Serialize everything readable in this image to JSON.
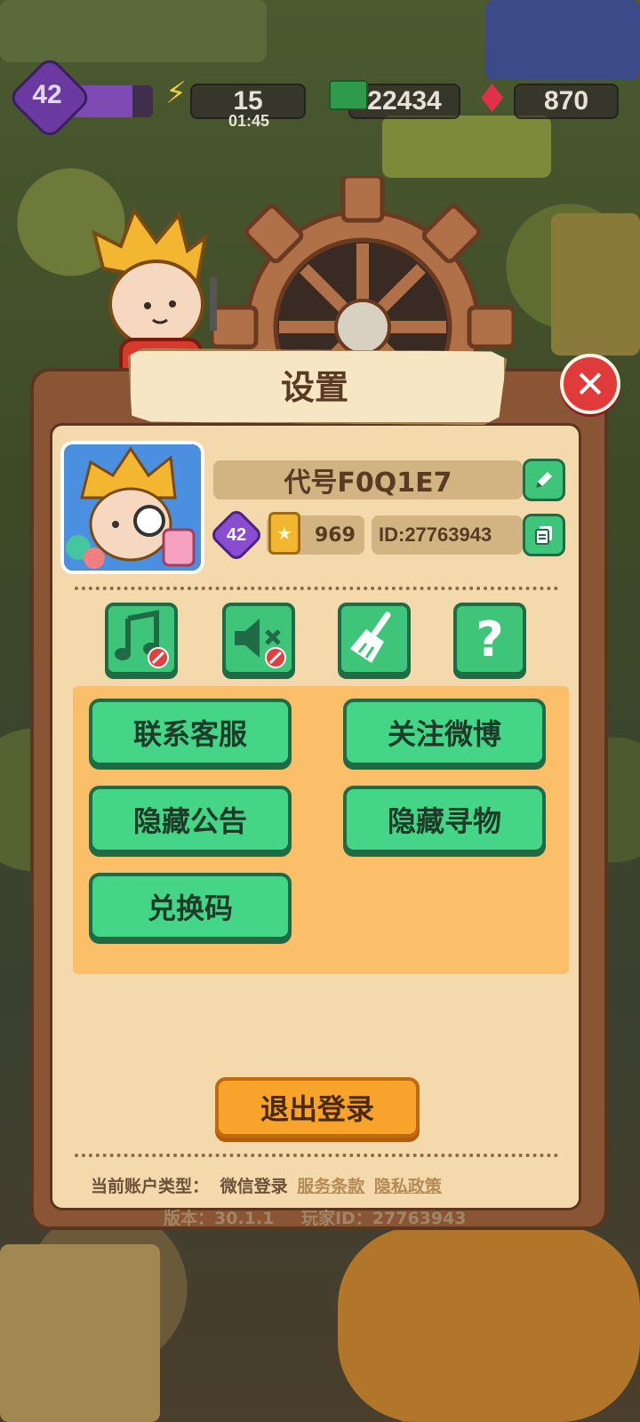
{
  "hud": {
    "level": "42",
    "xp_fraction": 0.75,
    "energy": "15",
    "energy_timer": "01:45",
    "cash": "22434",
    "gems": "870"
  },
  "dialog": {
    "title": "设置",
    "close_icon": "close-x-icon"
  },
  "profile": {
    "name": "代号F0Q1E7",
    "level": "42",
    "points": "969",
    "id": "ID:27763943"
  },
  "toggles": [
    {
      "name": "music-toggle",
      "icon": "music-note-muted-icon"
    },
    {
      "name": "sound-toggle",
      "icon": "speaker-muted-icon"
    },
    {
      "name": "clear-cache",
      "icon": "broom-icon"
    },
    {
      "name": "help",
      "icon": "question-mark-icon",
      "label": "?"
    }
  ],
  "menu": {
    "contact_support": "联系客服",
    "follow_weibo": "关注微博",
    "hide_announcement": "隐藏公告",
    "hide_search": "隐藏寻物",
    "redeem_code": "兑换码"
  },
  "logout_label": "退出登录",
  "footer": {
    "account_type_label": "当前账户类型：",
    "account_type_value": "微信登录",
    "terms": "服务条款",
    "privacy": "隐私政策",
    "version": "版本：30.1.1",
    "player_id": "玩家ID：27763943"
  },
  "colors": {
    "green_button": "#44d686",
    "orange_button": "#f7a32c",
    "panel_brown": "#8a5535",
    "panel_cream": "#f3d9ac",
    "close_red": "#e03a3a"
  }
}
